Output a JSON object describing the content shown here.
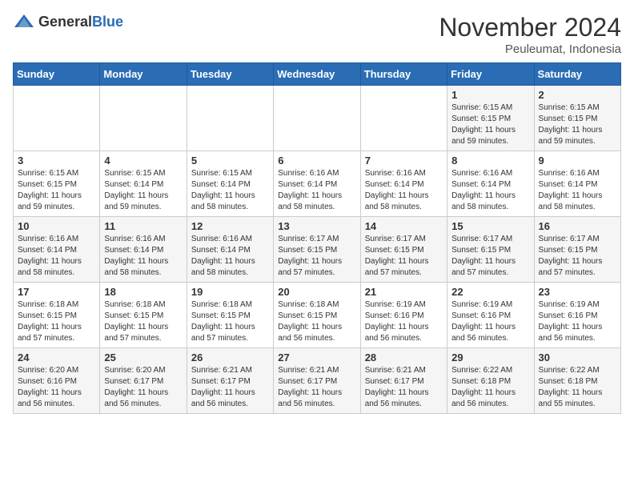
{
  "header": {
    "logo_general": "General",
    "logo_blue": "Blue",
    "month_title": "November 2024",
    "location": "Peuleumat, Indonesia"
  },
  "weekdays": [
    "Sunday",
    "Monday",
    "Tuesday",
    "Wednesday",
    "Thursday",
    "Friday",
    "Saturday"
  ],
  "weeks": [
    [
      {
        "day": "",
        "info": ""
      },
      {
        "day": "",
        "info": ""
      },
      {
        "day": "",
        "info": ""
      },
      {
        "day": "",
        "info": ""
      },
      {
        "day": "",
        "info": ""
      },
      {
        "day": "1",
        "info": "Sunrise: 6:15 AM\nSunset: 6:15 PM\nDaylight: 11 hours and 59 minutes."
      },
      {
        "day": "2",
        "info": "Sunrise: 6:15 AM\nSunset: 6:15 PM\nDaylight: 11 hours and 59 minutes."
      }
    ],
    [
      {
        "day": "3",
        "info": "Sunrise: 6:15 AM\nSunset: 6:15 PM\nDaylight: 11 hours and 59 minutes."
      },
      {
        "day": "4",
        "info": "Sunrise: 6:15 AM\nSunset: 6:14 PM\nDaylight: 11 hours and 59 minutes."
      },
      {
        "day": "5",
        "info": "Sunrise: 6:15 AM\nSunset: 6:14 PM\nDaylight: 11 hours and 58 minutes."
      },
      {
        "day": "6",
        "info": "Sunrise: 6:16 AM\nSunset: 6:14 PM\nDaylight: 11 hours and 58 minutes."
      },
      {
        "day": "7",
        "info": "Sunrise: 6:16 AM\nSunset: 6:14 PM\nDaylight: 11 hours and 58 minutes."
      },
      {
        "day": "8",
        "info": "Sunrise: 6:16 AM\nSunset: 6:14 PM\nDaylight: 11 hours and 58 minutes."
      },
      {
        "day": "9",
        "info": "Sunrise: 6:16 AM\nSunset: 6:14 PM\nDaylight: 11 hours and 58 minutes."
      }
    ],
    [
      {
        "day": "10",
        "info": "Sunrise: 6:16 AM\nSunset: 6:14 PM\nDaylight: 11 hours and 58 minutes."
      },
      {
        "day": "11",
        "info": "Sunrise: 6:16 AM\nSunset: 6:14 PM\nDaylight: 11 hours and 58 minutes."
      },
      {
        "day": "12",
        "info": "Sunrise: 6:16 AM\nSunset: 6:14 PM\nDaylight: 11 hours and 58 minutes."
      },
      {
        "day": "13",
        "info": "Sunrise: 6:17 AM\nSunset: 6:15 PM\nDaylight: 11 hours and 57 minutes."
      },
      {
        "day": "14",
        "info": "Sunrise: 6:17 AM\nSunset: 6:15 PM\nDaylight: 11 hours and 57 minutes."
      },
      {
        "day": "15",
        "info": "Sunrise: 6:17 AM\nSunset: 6:15 PM\nDaylight: 11 hours and 57 minutes."
      },
      {
        "day": "16",
        "info": "Sunrise: 6:17 AM\nSunset: 6:15 PM\nDaylight: 11 hours and 57 minutes."
      }
    ],
    [
      {
        "day": "17",
        "info": "Sunrise: 6:18 AM\nSunset: 6:15 PM\nDaylight: 11 hours and 57 minutes."
      },
      {
        "day": "18",
        "info": "Sunrise: 6:18 AM\nSunset: 6:15 PM\nDaylight: 11 hours and 57 minutes."
      },
      {
        "day": "19",
        "info": "Sunrise: 6:18 AM\nSunset: 6:15 PM\nDaylight: 11 hours and 57 minutes."
      },
      {
        "day": "20",
        "info": "Sunrise: 6:18 AM\nSunset: 6:15 PM\nDaylight: 11 hours and 56 minutes."
      },
      {
        "day": "21",
        "info": "Sunrise: 6:19 AM\nSunset: 6:16 PM\nDaylight: 11 hours and 56 minutes."
      },
      {
        "day": "22",
        "info": "Sunrise: 6:19 AM\nSunset: 6:16 PM\nDaylight: 11 hours and 56 minutes."
      },
      {
        "day": "23",
        "info": "Sunrise: 6:19 AM\nSunset: 6:16 PM\nDaylight: 11 hours and 56 minutes."
      }
    ],
    [
      {
        "day": "24",
        "info": "Sunrise: 6:20 AM\nSunset: 6:16 PM\nDaylight: 11 hours and 56 minutes."
      },
      {
        "day": "25",
        "info": "Sunrise: 6:20 AM\nSunset: 6:17 PM\nDaylight: 11 hours and 56 minutes."
      },
      {
        "day": "26",
        "info": "Sunrise: 6:21 AM\nSunset: 6:17 PM\nDaylight: 11 hours and 56 minutes."
      },
      {
        "day": "27",
        "info": "Sunrise: 6:21 AM\nSunset: 6:17 PM\nDaylight: 11 hours and 56 minutes."
      },
      {
        "day": "28",
        "info": "Sunrise: 6:21 AM\nSunset: 6:17 PM\nDaylight: 11 hours and 56 minutes."
      },
      {
        "day": "29",
        "info": "Sunrise: 6:22 AM\nSunset: 6:18 PM\nDaylight: 11 hours and 56 minutes."
      },
      {
        "day": "30",
        "info": "Sunrise: 6:22 AM\nSunset: 6:18 PM\nDaylight: 11 hours and 55 minutes."
      }
    ]
  ]
}
